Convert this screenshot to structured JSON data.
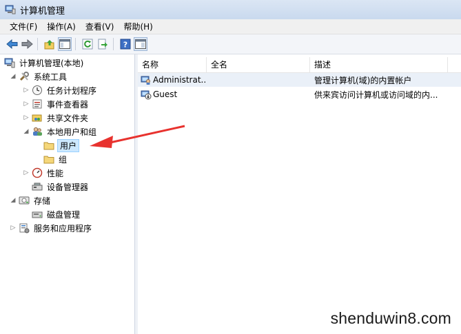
{
  "window": {
    "title": "计算机管理"
  },
  "menu": [
    {
      "label": "文件(F)"
    },
    {
      "label": "操作(A)"
    },
    {
      "label": "查看(V)"
    },
    {
      "label": "帮助(H)"
    }
  ],
  "toolbar": {
    "buttons": [
      "back-arrow-icon",
      "forward-arrow-icon",
      "up-folder-icon",
      "show-hide-tree-icon",
      "refresh-icon",
      "export-icon",
      "help-icon",
      "action-pane-icon"
    ]
  },
  "tree": {
    "root": "计算机管理(本地)",
    "system_tools": "系统工具",
    "task_scheduler": "任务计划程序",
    "event_viewer": "事件查看器",
    "shared_folders": "共享文件夹",
    "local_users_groups": "本地用户和组",
    "users": "用户",
    "groups": "组",
    "performance": "性能",
    "device_manager": "设备管理器",
    "storage": "存储",
    "disk_management": "磁盘管理",
    "services_apps": "服务和应用程序"
  },
  "list": {
    "columns": [
      "名称",
      "全名",
      "描述"
    ],
    "rows": [
      {
        "name": "Administrat...",
        "full_name": "",
        "description": "管理计算机(域)的内置帐户"
      },
      {
        "name": "Guest",
        "full_name": "",
        "description": "供来宾访问计算机或访问域的内..."
      }
    ]
  },
  "watermark": "shenduwin8.com",
  "colors": {
    "annotation_arrow": "#e8322e",
    "selection": "#cce8ff"
  }
}
